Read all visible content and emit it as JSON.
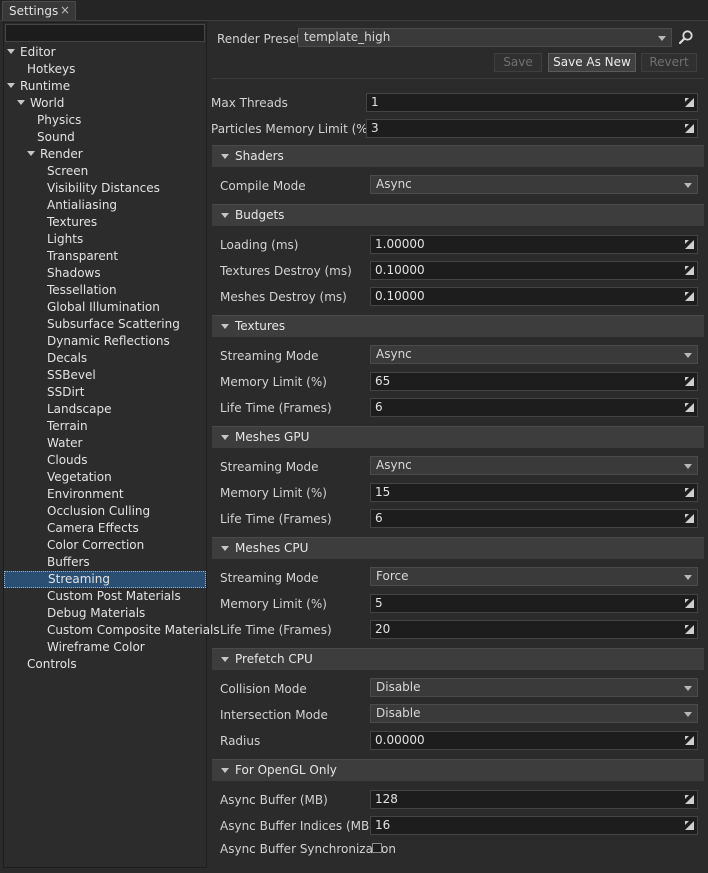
{
  "tab": {
    "label": "Settings",
    "close": "×"
  },
  "tree": {
    "filter_value": "",
    "items": [
      {
        "label": "Editor",
        "indent": 0,
        "arrow": true
      },
      {
        "label": "Hotkeys",
        "indent": 1,
        "arrow": false
      },
      {
        "label": "Runtime",
        "indent": 0,
        "arrow": true
      },
      {
        "label": "World",
        "indent": 1,
        "arrow": true
      },
      {
        "label": "Physics",
        "indent": 2,
        "arrow": false
      },
      {
        "label": "Sound",
        "indent": 2,
        "arrow": false
      },
      {
        "label": "Render",
        "indent": 2,
        "arrow": true
      },
      {
        "label": "Screen",
        "indent": 3,
        "arrow": false
      },
      {
        "label": "Visibility Distances",
        "indent": 3,
        "arrow": false
      },
      {
        "label": "Antialiasing",
        "indent": 3,
        "arrow": false
      },
      {
        "label": "Textures",
        "indent": 3,
        "arrow": false
      },
      {
        "label": "Lights",
        "indent": 3,
        "arrow": false
      },
      {
        "label": "Transparent",
        "indent": 3,
        "arrow": false
      },
      {
        "label": "Shadows",
        "indent": 3,
        "arrow": false
      },
      {
        "label": "Tessellation",
        "indent": 3,
        "arrow": false
      },
      {
        "label": "Global Illumination",
        "indent": 3,
        "arrow": false
      },
      {
        "label": "Subsurface Scattering",
        "indent": 3,
        "arrow": false
      },
      {
        "label": "Dynamic Reflections",
        "indent": 3,
        "arrow": false
      },
      {
        "label": "Decals",
        "indent": 3,
        "arrow": false
      },
      {
        "label": "SSBevel",
        "indent": 3,
        "arrow": false
      },
      {
        "label": "SSDirt",
        "indent": 3,
        "arrow": false
      },
      {
        "label": "Landscape",
        "indent": 3,
        "arrow": false
      },
      {
        "label": "Terrain",
        "indent": 3,
        "arrow": false
      },
      {
        "label": "Water",
        "indent": 3,
        "arrow": false
      },
      {
        "label": "Clouds",
        "indent": 3,
        "arrow": false
      },
      {
        "label": "Vegetation",
        "indent": 3,
        "arrow": false
      },
      {
        "label": "Environment",
        "indent": 3,
        "arrow": false
      },
      {
        "label": "Occlusion Culling",
        "indent": 3,
        "arrow": false
      },
      {
        "label": "Camera Effects",
        "indent": 3,
        "arrow": false
      },
      {
        "label": "Color Correction",
        "indent": 3,
        "arrow": false
      },
      {
        "label": "Buffers",
        "indent": 3,
        "arrow": false
      },
      {
        "label": "Streaming",
        "indent": 3,
        "arrow": false,
        "selected": true
      },
      {
        "label": "Custom Post Materials",
        "indent": 3,
        "arrow": false
      },
      {
        "label": "Debug Materials",
        "indent": 3,
        "arrow": false
      },
      {
        "label": "Custom Composite Materials",
        "indent": 3,
        "arrow": false
      },
      {
        "label": "Wireframe Color",
        "indent": 3,
        "arrow": false
      },
      {
        "label": "Controls",
        "indent": 1,
        "arrow": false
      }
    ]
  },
  "preset": {
    "label": "Render Preset:",
    "value": "template_high"
  },
  "buttons": {
    "save": "Save",
    "save_as_new": "Save As New",
    "revert": "Revert"
  },
  "general": {
    "max_threads": {
      "label": "Max Threads",
      "value": "1"
    },
    "particles_memory": {
      "label": "Particles Memory Limit (%)",
      "value": "3"
    }
  },
  "shaders": {
    "title": "Shaders",
    "compile_mode": {
      "label": "Compile Mode",
      "value": "Async"
    }
  },
  "budgets": {
    "title": "Budgets",
    "loading": {
      "label": "Loading (ms)",
      "value": "1.00000"
    },
    "textures_destroy": {
      "label": "Textures Destroy (ms)",
      "value": "0.10000"
    },
    "meshes_destroy": {
      "label": "Meshes Destroy (ms)",
      "value": "0.10000"
    }
  },
  "textures": {
    "title": "Textures",
    "streaming_mode": {
      "label": "Streaming Mode",
      "value": "Async"
    },
    "memory_limit": {
      "label": "Memory Limit (%)",
      "value": "65"
    },
    "life_time": {
      "label": "Life Time (Frames)",
      "value": "6"
    }
  },
  "meshes_gpu": {
    "title": "Meshes GPU",
    "streaming_mode": {
      "label": "Streaming Mode",
      "value": "Async"
    },
    "memory_limit": {
      "label": "Memory Limit (%)",
      "value": "15"
    },
    "life_time": {
      "label": "Life Time (Frames)",
      "value": "6"
    }
  },
  "meshes_cpu": {
    "title": "Meshes CPU",
    "streaming_mode": {
      "label": "Streaming Mode",
      "value": "Force"
    },
    "memory_limit": {
      "label": "Memory Limit (%)",
      "value": "5"
    },
    "life_time": {
      "label": "Life Time (Frames)",
      "value": "20"
    }
  },
  "prefetch_cpu": {
    "title": "Prefetch CPU",
    "collision_mode": {
      "label": "Collision Mode",
      "value": "Disable"
    },
    "intersection_mode": {
      "label": "Intersection Mode",
      "value": "Disable"
    },
    "radius": {
      "label": "Radius",
      "value": "0.00000"
    }
  },
  "opengl": {
    "title": "For OpenGL Only",
    "async_buffer": {
      "label": "Async Buffer (MB)",
      "value": "128"
    },
    "async_buffer_indices": {
      "label": "Async Buffer Indices (MB)",
      "value": "16"
    },
    "async_buffer_sync": {
      "label": "Async Buffer Synchronization",
      "checked": false
    }
  }
}
